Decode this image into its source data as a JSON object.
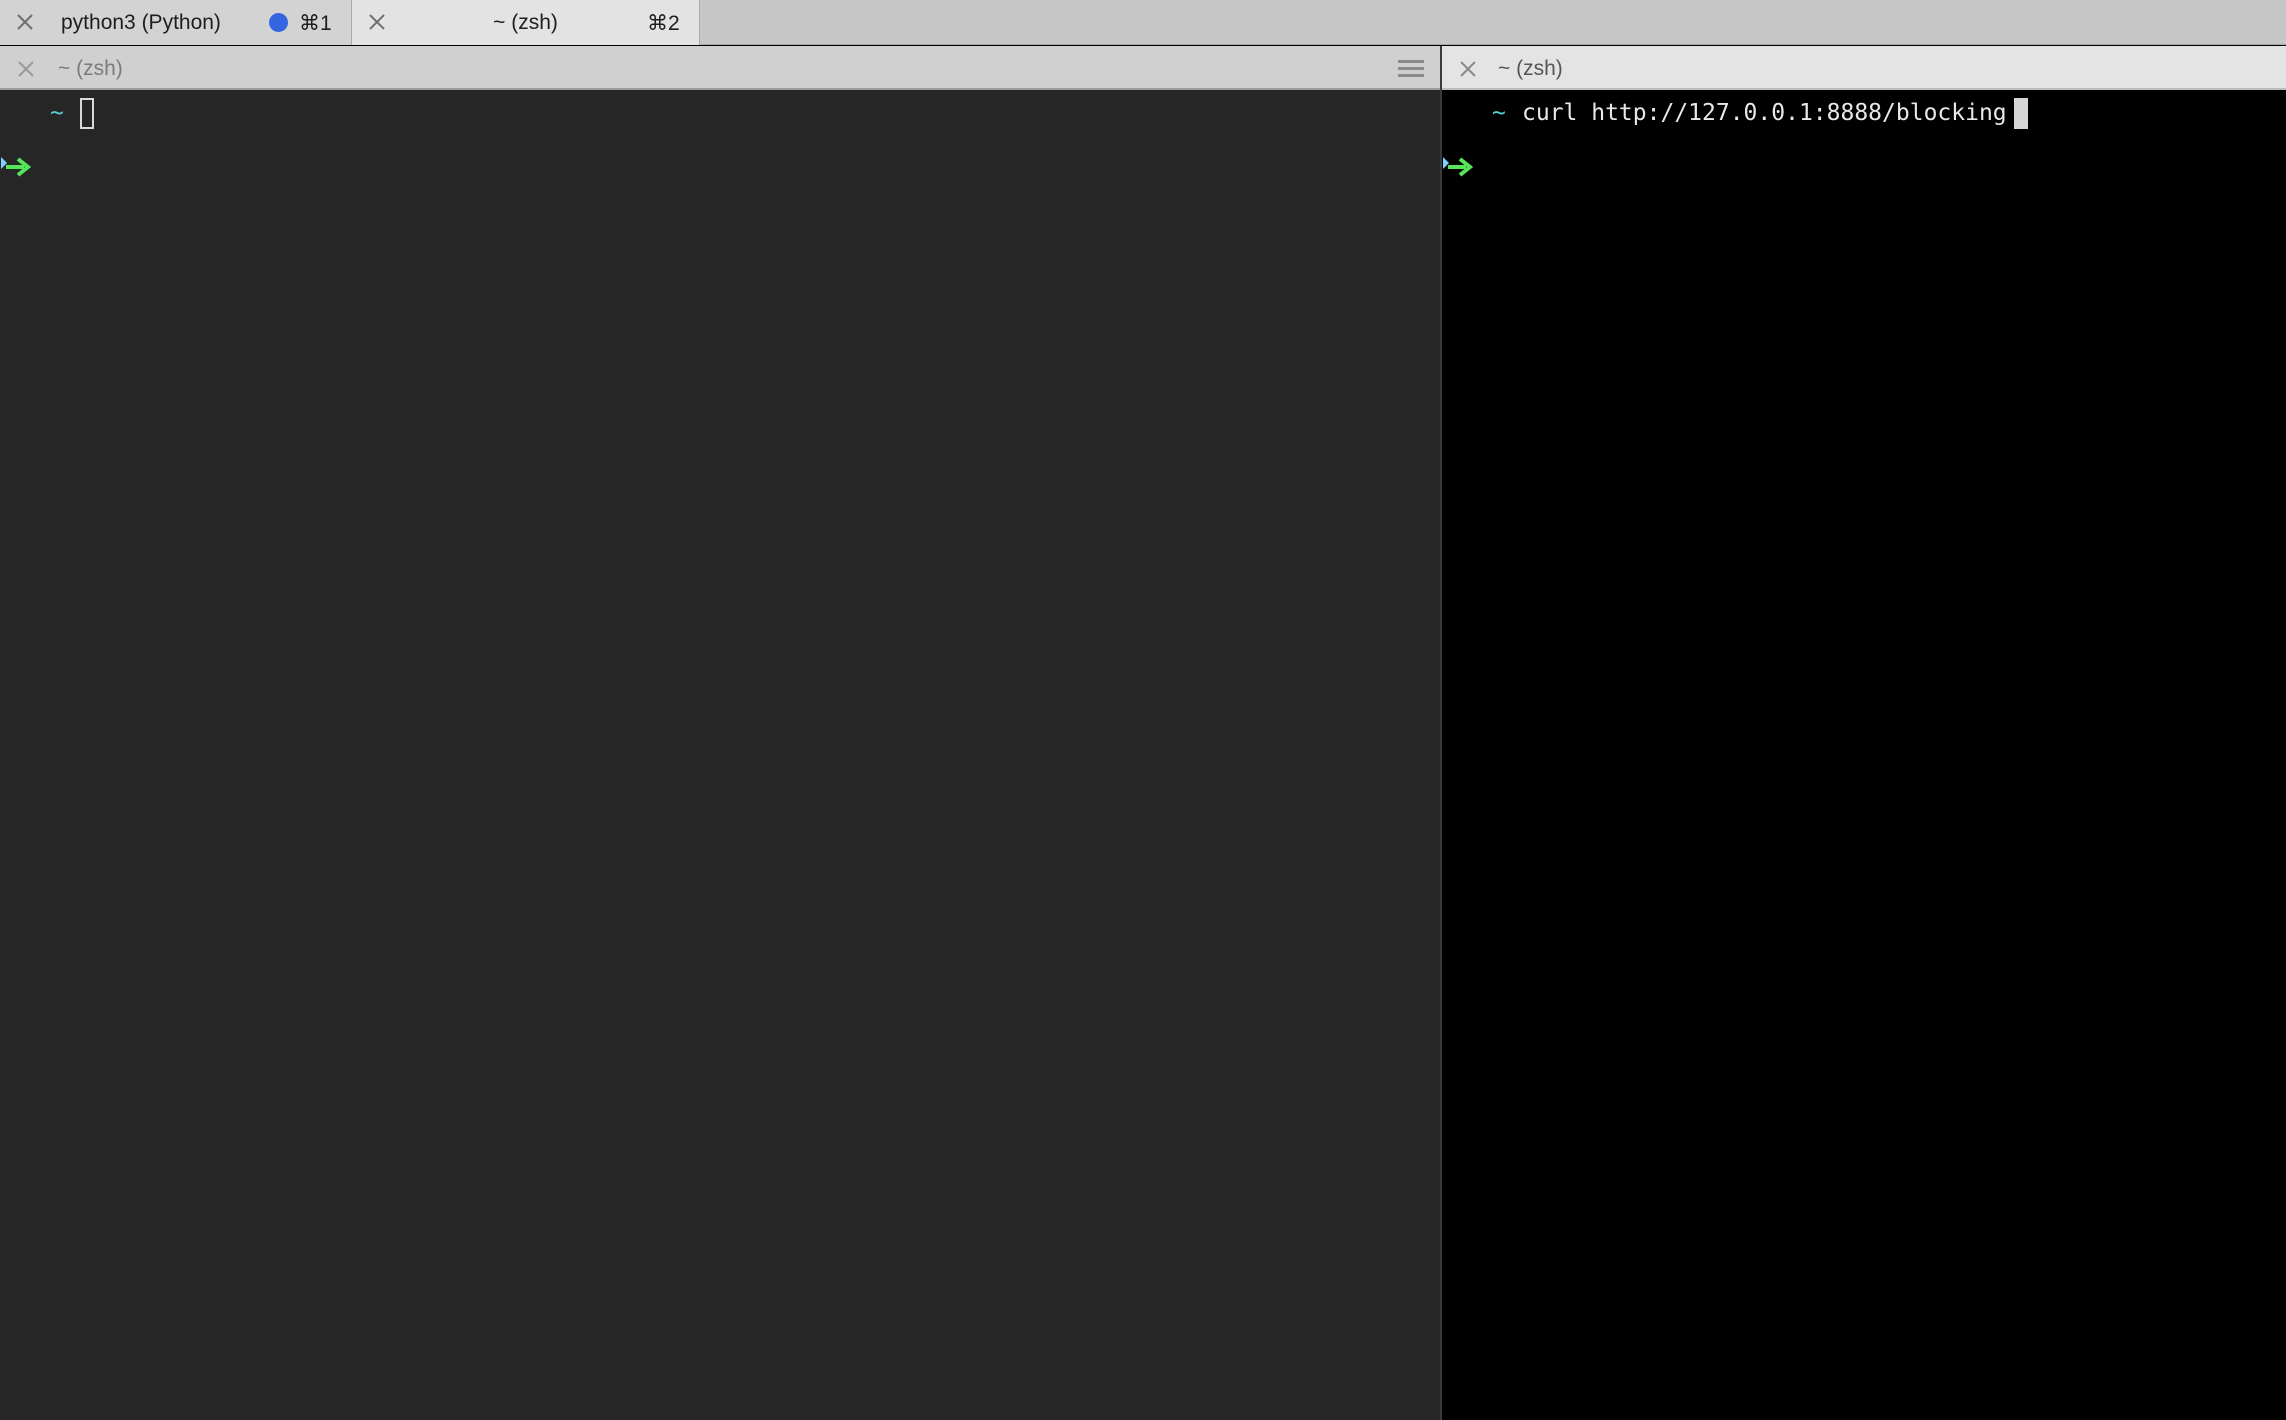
{
  "tabs": [
    {
      "title": "python3 (Python)",
      "shortcut": "⌘1",
      "has_activity": true,
      "activity_color": "#3366e0"
    },
    {
      "title": "~ (zsh)",
      "shortcut": "⌘2"
    }
  ],
  "panes": {
    "left": {
      "title": "~ (zsh)",
      "prompt_tilde": "~",
      "command": ""
    },
    "right": {
      "title": "~ (zsh)",
      "prompt_tilde": "~",
      "command": "curl http://127.0.0.1:8888/blocking"
    }
  },
  "colors": {
    "prompt_arrow": "#55e45a",
    "prompt_tilde": "#55d0d6",
    "left_background": "#262626",
    "right_background": "#000000"
  }
}
